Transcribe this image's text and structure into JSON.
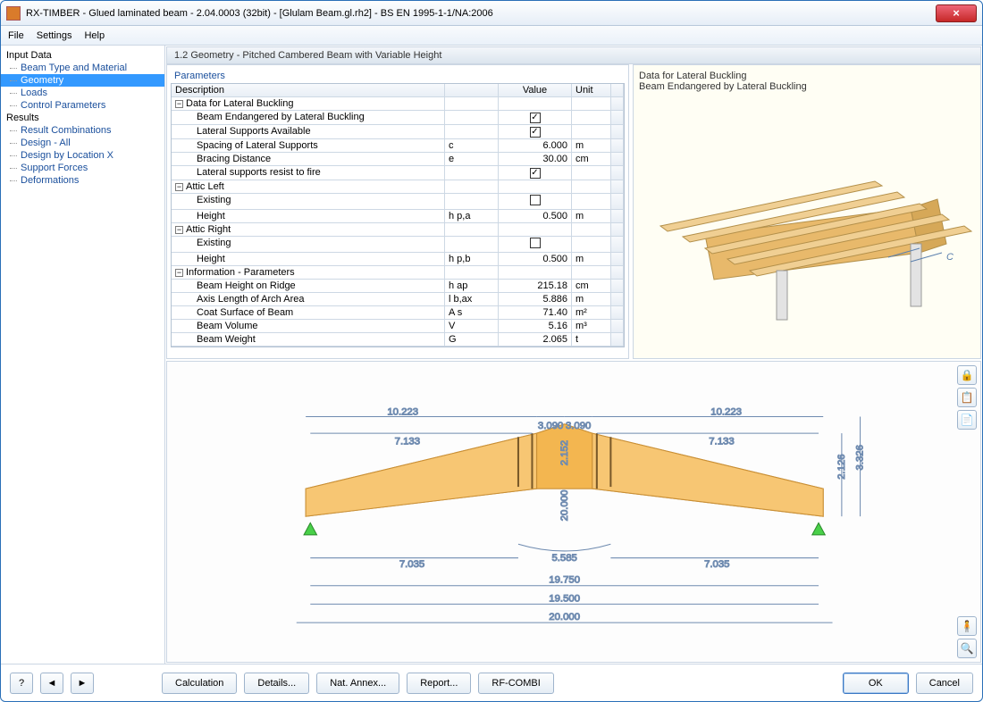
{
  "window": {
    "title": "RX-TIMBER - Glued laminated beam - 2.04.0003 (32bit) - [Glulam Beam.gl.rh2] - BS EN 1995-1-1/NA:2006"
  },
  "menu": {
    "file": "File",
    "settings": "Settings",
    "help": "Help"
  },
  "tree": {
    "input": "Input Data",
    "beamtype": "Beam Type and Material",
    "geometry": "Geometry",
    "loads": "Loads",
    "control": "Control Parameters",
    "results": "Results",
    "combos": "Result Combinations",
    "designall": "Design - All",
    "designloc": "Design by Location X",
    "support": "Support Forces",
    "deform": "Deformations"
  },
  "section": {
    "title": "1.2 Geometry  -  Pitched Cambered Beam with Variable Height"
  },
  "params": {
    "label": "Parameters",
    "head_desc": "Description",
    "head_val": "Value",
    "head_unit": "Unit",
    "g_lateral": "Data for Lateral Buckling",
    "r_endanger": "Beam Endangered by Lateral Buckling",
    "r_supports": "Lateral Supports Available",
    "r_spacing": "Spacing of Lateral Supports",
    "r_spacing_sym": "c",
    "r_spacing_val": "6.000",
    "r_spacing_unit": "m",
    "r_bracing": "Bracing Distance",
    "r_bracing_sym": "e",
    "r_bracing_val": "30.00",
    "r_bracing_unit": "cm",
    "r_fire": "Lateral supports resist to fire",
    "g_atticl": "Attic Left",
    "r_al_exist": "Existing",
    "r_al_h": "Height",
    "r_al_h_sym": "h p,a",
    "r_al_h_val": "0.500",
    "r_al_h_unit": "m",
    "g_atticr": "Attic Right",
    "r_ar_exist": "Existing",
    "r_ar_h": "Height",
    "r_ar_h_sym": "h p,b",
    "r_ar_h_val": "0.500",
    "r_ar_h_unit": "m",
    "g_info": "Information - Parameters",
    "r_ridge": "Beam Height on Ridge",
    "r_ridge_sym": "h ap",
    "r_ridge_val": "215.18",
    "r_ridge_unit": "cm",
    "r_axis": "Axis Length of Arch Area",
    "r_axis_sym": "l b,ax",
    "r_axis_val": "5.886",
    "r_axis_unit": "m",
    "r_coat": "Coat Surface of Beam",
    "r_coat_sym": "A s",
    "r_coat_val": "71.40",
    "r_coat_unit": "m²",
    "r_vol": "Beam Volume",
    "r_vol_sym": "V",
    "r_vol_val": "5.16",
    "r_vol_unit": "m³",
    "r_weight": "Beam Weight",
    "r_weight_sym": "G",
    "r_weight_val": "2.065",
    "r_weight_unit": "t"
  },
  "info": {
    "line1": "Data for Lateral Buckling",
    "line2": "Beam Endangered by Lateral Buckling",
    "c_label": "C"
  },
  "diagram": {
    "d1": "10.223",
    "d2": "3.090",
    "d3": "3.090",
    "d4": "10.223",
    "d5": "7.133",
    "d6": "7.133",
    "h1": "2.152",
    "h2": "2.126",
    "h3": "3.326",
    "r1": "20.000",
    "s1": "5.585",
    "b1": "7.035",
    "b2": "7.035",
    "t1": "19.750",
    "t2": "19.500",
    "t3": "20.000"
  },
  "buttons": {
    "calc": "Calculation",
    "details": "Details...",
    "nat": "Nat. Annex...",
    "report": "Report...",
    "combi": "RF-COMBI",
    "ok": "OK",
    "cancel": "Cancel"
  }
}
